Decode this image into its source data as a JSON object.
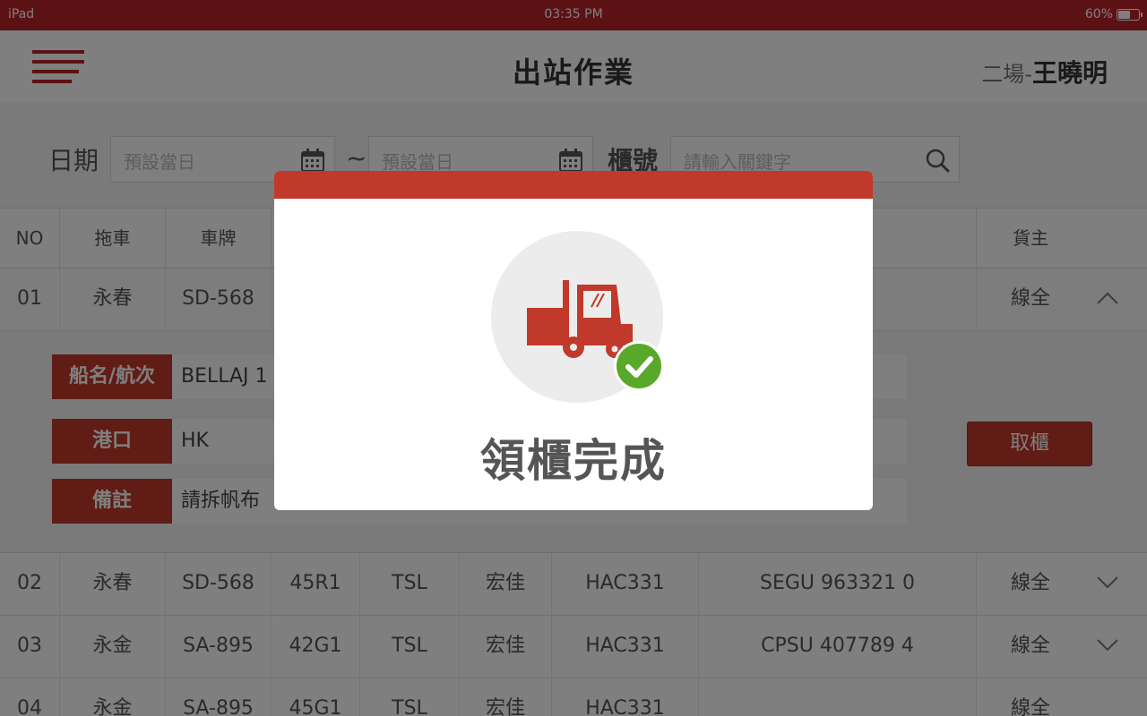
{
  "status_bar": {
    "device": "iPad",
    "time": "03:35 PM",
    "battery": "60%",
    "battery_level": 0.6
  },
  "header": {
    "title": "出站作業",
    "user_prefix": "二場-",
    "user_name": "王曉明"
  },
  "filter": {
    "date_label": "日期",
    "date_from_placeholder": "預設當日",
    "separator": "~",
    "date_to_placeholder": "預設當日",
    "container_label": "櫃號",
    "search_placeholder": "請輸入關鍵字"
  },
  "table": {
    "headers": [
      "NO",
      "拖車",
      "車牌",
      "貨主"
    ],
    "rows": [
      {
        "no": "01",
        "trailer": "永春",
        "plate": "SD-568",
        "container": "----",
        "owner": "線全"
      },
      {
        "no": "02",
        "trailer": "永春",
        "plate": "SD-568",
        "type": "45R1",
        "carrier": "TSL",
        "agent": "宏佳",
        "code": "HAC331",
        "container": "SEGU 963321 0",
        "owner": "線全"
      },
      {
        "no": "03",
        "trailer": "永金",
        "plate": "SA-895",
        "type": "42G1",
        "carrier": "TSL",
        "agent": "宏佳",
        "code": "HAC331",
        "container": "CPSU  407789  4",
        "owner": "線全"
      },
      {
        "no": "04",
        "trailer": "永金",
        "plate": "SA-895",
        "type": "45G1",
        "carrier": "TSL",
        "agent": "宏佳",
        "code": "HAC331",
        "container": "",
        "owner": "線全"
      }
    ]
  },
  "detail": {
    "vessel_label": "船名/航次",
    "vessel_value": "BELLAJ  1",
    "port_label": "港口",
    "port_value": "HK",
    "remark_label": "備註",
    "remark_value": "請拆帆布",
    "cancel_button": "取櫃"
  },
  "modal": {
    "message": "領櫃完成"
  },
  "colors": {
    "brand_red": "#c0392b",
    "success_green": "#5aa82a"
  }
}
